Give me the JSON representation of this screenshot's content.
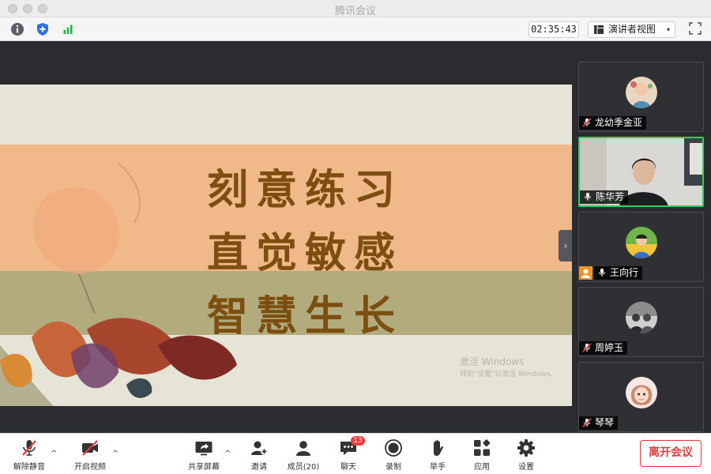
{
  "window": {
    "title": "腾讯会议"
  },
  "toolbar": {
    "timer": "02:35:43",
    "view_mode": "演讲者视图",
    "view_caret": "▾"
  },
  "slide": {
    "lines": [
      "刻意练习",
      "直觉敏感",
      "智慧生长"
    ],
    "watermark_line1": "激活 Windows",
    "watermark_line2": "转到\"设置\"以激活 Windows。"
  },
  "participants": [
    {
      "name": "龙幼季金亚",
      "muted": true
    },
    {
      "name": "陈华芳",
      "muted": false,
      "speaking": true
    },
    {
      "name": "王向行",
      "muted": false,
      "host": true
    },
    {
      "name": "周婷玉",
      "muted": true
    },
    {
      "name": "琴琴",
      "muted": true
    }
  ],
  "bottombar": {
    "unmute": "解除静音",
    "start_video": "开启视频",
    "share_screen": "共享屏幕",
    "invite": "邀请",
    "members": "成员(20)",
    "chat": "聊天",
    "chat_badge": "13",
    "record": "录制",
    "raise_hand": "举手",
    "apps": "应用",
    "settings": "设置",
    "leave": "离开会议",
    "caret": "^"
  },
  "colors": {
    "accent_green": "#2fcf5e",
    "leave_red": "#e33b3b",
    "badge_red": "#f33c3c",
    "slide_title": "#7c4f10",
    "host_orange": "#f0932b"
  }
}
